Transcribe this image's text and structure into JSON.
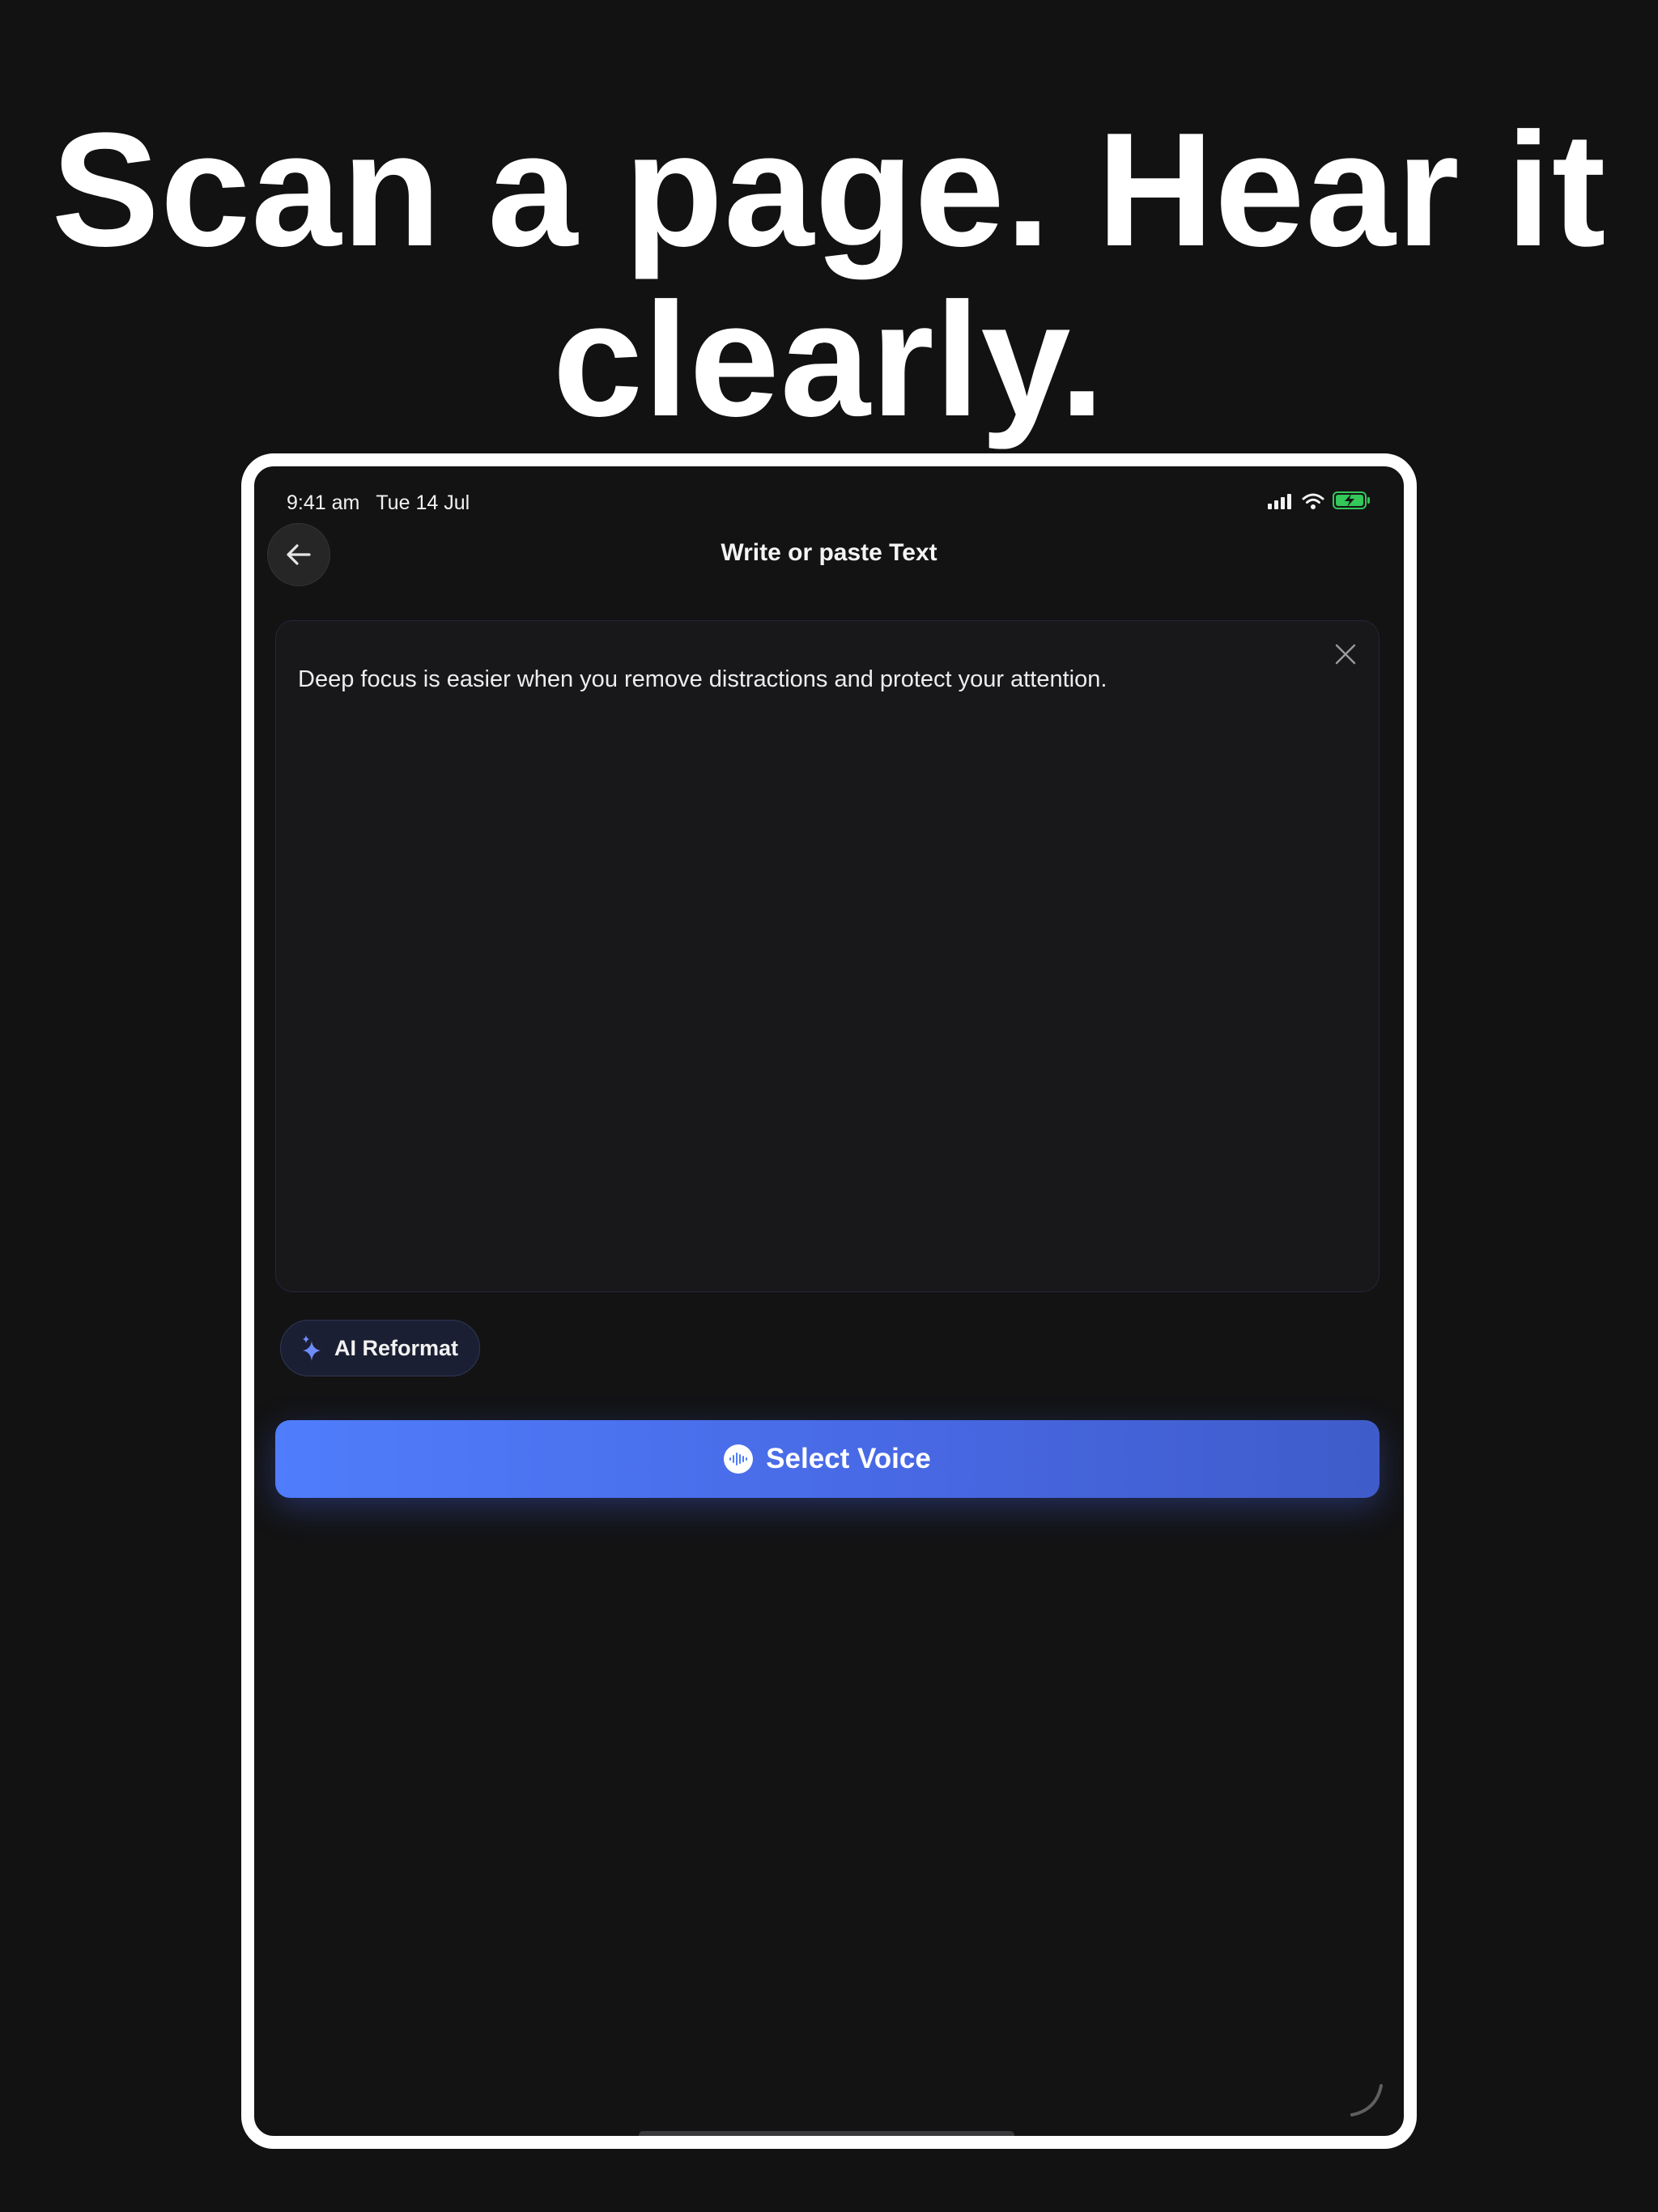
{
  "headline": {
    "line1": "Scan a page. Hear it",
    "line2": "clearly."
  },
  "status_bar": {
    "time": "9:41 am",
    "date": "Tue 14 Jul",
    "icons": [
      "cellular-signal-icon",
      "wifi-icon",
      "battery-charging-icon"
    ],
    "battery_color": "#34c759"
  },
  "nav": {
    "back_icon": "arrow-left-icon",
    "title": "Write or paste Text"
  },
  "editor": {
    "text": "Deep focus is easier when you remove distractions and protect your attention.",
    "clear_icon": "close-icon"
  },
  "reformat": {
    "label": "AI Reformat",
    "icon": "sparkle-icon",
    "icon_color": "#6f8cff"
  },
  "primary_action": {
    "label": "Select Voice",
    "icon": "waveform-icon",
    "color": "#4f7dfb"
  }
}
